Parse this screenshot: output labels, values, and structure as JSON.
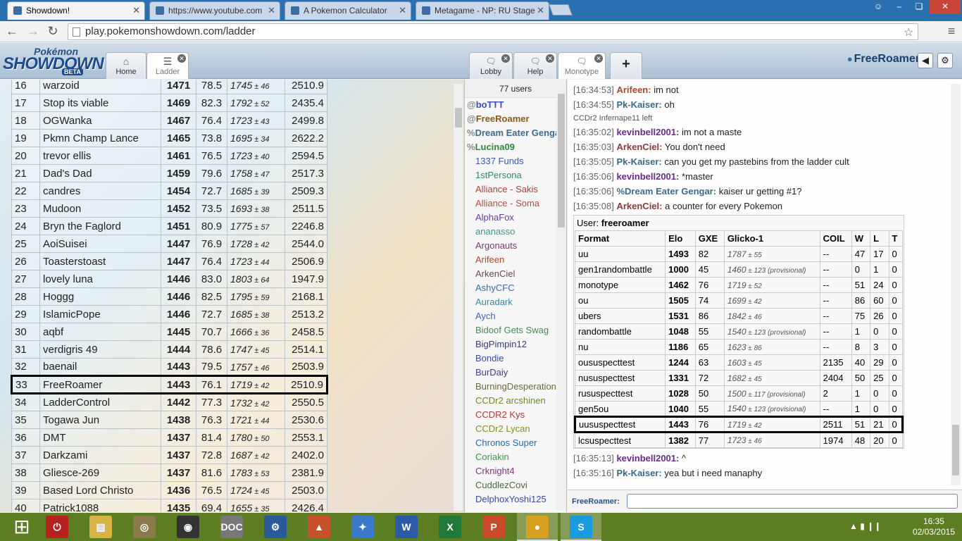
{
  "browser": {
    "tabs": [
      {
        "title": "Showdown!",
        "active": true
      },
      {
        "title": "https://www.youtube.com",
        "active": false
      },
      {
        "title": "A Pokemon Calculator",
        "active": false
      },
      {
        "title": "Metagame - NP: RU Stage",
        "active": false
      }
    ],
    "url": "play.pokemonshowdown.com/ladder",
    "window_buttons": {
      "user": "☺",
      "minimize": "–",
      "restore": "❏",
      "close": "✕"
    },
    "nav": {
      "back": "←",
      "forward": "→",
      "reload": "↻",
      "bookmark": "☆",
      "menu": "≡"
    }
  },
  "showdown": {
    "logo": {
      "line1": "Pokémon",
      "line2": "SHOWDOWN",
      "line3": "BETA"
    },
    "left_tabs": [
      {
        "label": "Home",
        "icon": "home-icon",
        "glyph": "⌂"
      },
      {
        "label": "Ladder",
        "icon": "ladder-icon",
        "glyph": "☰"
      }
    ],
    "room_tabs": [
      {
        "label": "Lobby",
        "icon": "chat-bubble-icon",
        "glyph": "🗨"
      },
      {
        "label": "Help",
        "icon": "chat-bubble-icon",
        "glyph": "🗨"
      },
      {
        "label": "Monotype",
        "icon": "chat-bubble-icon",
        "glyph": "🗨"
      }
    ],
    "add_tab": "+",
    "username": "FreeRoamer",
    "sound_glyph": "◀",
    "settings_glyph": "⚙",
    "close_glyph": "✕"
  },
  "ladder": {
    "rows": [
      {
        "rank": "16",
        "name": "warzoid",
        "elo": "1471",
        "gxe": "78.5",
        "glicko": "1745",
        "dev": "46",
        "coil": "2510.9"
      },
      {
        "rank": "17",
        "name": "Stop its viable",
        "elo": "1469",
        "gxe": "82.3",
        "glicko": "1792",
        "dev": "52",
        "coil": "2435.4"
      },
      {
        "rank": "18",
        "name": "OGWanka",
        "elo": "1467",
        "gxe": "76.4",
        "glicko": "1723",
        "dev": "43",
        "coil": "2499.8"
      },
      {
        "rank": "19",
        "name": "Pkmn Champ Lance",
        "elo": "1465",
        "gxe": "73.8",
        "glicko": "1695",
        "dev": "34",
        "coil": "2622.2"
      },
      {
        "rank": "20",
        "name": "trevor ellis",
        "elo": "1461",
        "gxe": "76.5",
        "glicko": "1723",
        "dev": "40",
        "coil": "2594.5"
      },
      {
        "rank": "21",
        "name": "Dad's Dad",
        "elo": "1459",
        "gxe": "79.6",
        "glicko": "1758",
        "dev": "47",
        "coil": "2517.3"
      },
      {
        "rank": "22",
        "name": "candres",
        "elo": "1454",
        "gxe": "72.7",
        "glicko": "1685",
        "dev": "39",
        "coil": "2509.3"
      },
      {
        "rank": "23",
        "name": "Mudoon",
        "elo": "1452",
        "gxe": "73.5",
        "glicko": "1693",
        "dev": "38",
        "coil": "2511.5"
      },
      {
        "rank": "24",
        "name": "Bryn the Faglord",
        "elo": "1451",
        "gxe": "80.9",
        "glicko": "1775",
        "dev": "57",
        "coil": "2246.8"
      },
      {
        "rank": "25",
        "name": "AoiSuisei",
        "elo": "1447",
        "gxe": "76.9",
        "glicko": "1728",
        "dev": "42",
        "coil": "2544.0"
      },
      {
        "rank": "26",
        "name": "Toasterstoast",
        "elo": "1447",
        "gxe": "76.4",
        "glicko": "1723",
        "dev": "44",
        "coil": "2506.9"
      },
      {
        "rank": "27",
        "name": "lovely luna",
        "elo": "1446",
        "gxe": "83.0",
        "glicko": "1803",
        "dev": "64",
        "coil": "1947.9"
      },
      {
        "rank": "28",
        "name": "Hoggg",
        "elo": "1446",
        "gxe": "82.5",
        "glicko": "1795",
        "dev": "59",
        "coil": "2168.1"
      },
      {
        "rank": "29",
        "name": "IslamicPope",
        "elo": "1446",
        "gxe": "72.7",
        "glicko": "1685",
        "dev": "38",
        "coil": "2513.2"
      },
      {
        "rank": "30",
        "name": "aqbf",
        "elo": "1445",
        "gxe": "70.7",
        "glicko": "1666",
        "dev": "36",
        "coil": "2458.5"
      },
      {
        "rank": "31",
        "name": "verdigris 49",
        "elo": "1444",
        "gxe": "78.6",
        "glicko": "1747",
        "dev": "45",
        "coil": "2514.1"
      },
      {
        "rank": "32",
        "name": "baenail",
        "elo": "1443",
        "gxe": "79.5",
        "glicko": "1757",
        "dev": "46",
        "coil": "2503.9"
      },
      {
        "rank": "33",
        "name": "FreeRoamer",
        "elo": "1443",
        "gxe": "76.1",
        "glicko": "1719",
        "dev": "42",
        "coil": "2510.9",
        "highlight": true
      },
      {
        "rank": "34",
        "name": "LadderControl",
        "elo": "1442",
        "gxe": "77.3",
        "glicko": "1732",
        "dev": "42",
        "coil": "2550.5"
      },
      {
        "rank": "35",
        "name": "Togawa Jun",
        "elo": "1438",
        "gxe": "76.3",
        "glicko": "1721",
        "dev": "44",
        "coil": "2530.6"
      },
      {
        "rank": "36",
        "name": "DMT",
        "elo": "1437",
        "gxe": "81.4",
        "glicko": "1780",
        "dev": "50",
        "coil": "2553.1"
      },
      {
        "rank": "37",
        "name": "Darkzami",
        "elo": "1437",
        "gxe": "72.8",
        "glicko": "1687",
        "dev": "42",
        "coil": "2402.0"
      },
      {
        "rank": "38",
        "name": "Gliesce-269",
        "elo": "1437",
        "gxe": "81.6",
        "glicko": "1783",
        "dev": "53",
        "coil": "2381.9"
      },
      {
        "rank": "39",
        "name": "Based Lord Christo",
        "elo": "1436",
        "gxe": "76.5",
        "glicko": "1724",
        "dev": "45",
        "coil": "2503.0"
      },
      {
        "rank": "40",
        "name": "Patrick1088",
        "elo": "1435",
        "gxe": "69.4",
        "glicko": "1655",
        "dev": "35",
        "coil": "2426.4"
      }
    ]
  },
  "userlist": {
    "count": "77 users",
    "users": [
      {
        "group": "@",
        "name": "boTTT",
        "color": "#3a4fc4",
        "bold": true
      },
      {
        "group": "@",
        "name": "FreeRoamer",
        "color": "#8a5a1a",
        "bold": true
      },
      {
        "group": "%",
        "name": "Dream Eater Gengar",
        "color": "#3d6b8a",
        "bold": true
      },
      {
        "group": "%",
        "name": "Lucina09",
        "color": "#2e8a3a",
        "bold": true
      },
      {
        "group": "",
        "name": "1337 Funds",
        "color": "#3a5ab0",
        "bold": false
      },
      {
        "group": "",
        "name": "1stPersona",
        "color": "#2d8a64",
        "bold": false
      },
      {
        "group": "",
        "name": "Alliance - Sakis",
        "color": "#a8443a",
        "bold": false
      },
      {
        "group": "",
        "name": "Alliance - Soma",
        "color": "#b0503a",
        "bold": false
      },
      {
        "group": "",
        "name": "AlphaFox",
        "color": "#6a3aa8",
        "bold": false
      },
      {
        "group": "",
        "name": "ananasso",
        "color": "#3a9a8a",
        "bold": false
      },
      {
        "group": "",
        "name": "Argonauts",
        "color": "#7a3a6a",
        "bold": false
      },
      {
        "group": "",
        "name": "Arifeen",
        "color": "#a84a2a",
        "bold": false
      },
      {
        "group": "",
        "name": "ArkenCiel",
        "color": "#6a4a4a",
        "bold": false
      },
      {
        "group": "",
        "name": "AshyCFC",
        "color": "#3a6ab0",
        "bold": false
      },
      {
        "group": "",
        "name": "Auradark",
        "color": "#3a8a9a",
        "bold": false
      },
      {
        "group": "",
        "name": "Aych",
        "color": "#3a6aa8",
        "bold": false
      },
      {
        "group": "",
        "name": "Bidoof Gets Swag",
        "color": "#4a8a5a",
        "bold": false
      },
      {
        "group": "",
        "name": "BigPimpin12",
        "color": "#3a3a7a",
        "bold": false
      },
      {
        "group": "",
        "name": "Bondie",
        "color": "#3a4ab0",
        "bold": false
      },
      {
        "group": "",
        "name": "BurDaiy",
        "color": "#4a3a8a",
        "bold": false
      },
      {
        "group": "",
        "name": "BurningDesperation",
        "color": "#6a6a3a",
        "bold": false
      },
      {
        "group": "",
        "name": "CCDr2 arcshinen",
        "color": "#6a8a2a",
        "bold": false
      },
      {
        "group": "",
        "name": "CCDR2 Kys",
        "color": "#b03a3a",
        "bold": false
      },
      {
        "group": "",
        "name": "CCDr2 Lycan",
        "color": "#8a8a2a",
        "bold": false
      },
      {
        "group": "",
        "name": "Chronos Super",
        "color": "#2a6ab0",
        "bold": false
      },
      {
        "group": "",
        "name": "Coriakin",
        "color": "#3a9a4a",
        "bold": false
      },
      {
        "group": "",
        "name": "Crknight4",
        "color": "#7a3a7a",
        "bold": false
      },
      {
        "group": "",
        "name": "CuddlezCovi",
        "color": "#4a6a3a",
        "bold": false
      },
      {
        "group": "",
        "name": "DelphoxYoshi125",
        "color": "#3a4aa8",
        "bold": false
      }
    ]
  },
  "chat": {
    "lines_top": [
      {
        "ts": "[16:34:53]",
        "who": "Arifeen:",
        "color": "#a84a2a",
        "msg": "im not"
      },
      {
        "ts": "[16:34:55]",
        "who": "Pk-Kaiser:",
        "color": "#3a6a8a",
        "msg": "oh"
      },
      {
        "notice": "CCDr2 Infernape11 left"
      },
      {
        "ts": "[16:35:02]",
        "who": "kevinbell2001:",
        "color": "#6a2a8a",
        "msg": "im not a maste"
      },
      {
        "ts": "[16:35:03]",
        "who": "ArkenCiel:",
        "color": "#8a3a3a",
        "msg": "You don't need"
      },
      {
        "ts": "[16:35:05]",
        "who": "Pk-Kaiser:",
        "color": "#3a6a8a",
        "msg": "can you get my pastebins from the ladder cult"
      },
      {
        "ts": "[16:35:06]",
        "who": "kevinbell2001:",
        "color": "#6a2a8a",
        "msg": "*master"
      },
      {
        "ts": "[16:35:06]",
        "who": "%Dream Eater Gengar:",
        "color": "#3d6b8a",
        "msg": "kaiser ur getting #1?"
      },
      {
        "ts": "[16:35:08]",
        "who": "ArkenCiel:",
        "color": "#8a3a3a",
        "msg": "a counter for every Pokemon"
      }
    ],
    "stats_user_label": "User:",
    "stats_user": "freeroamer",
    "stats_headers": [
      "Format",
      "Elo",
      "GXE",
      "Glicko-1",
      "COIL",
      "W",
      "L",
      "T"
    ],
    "stats_rows": [
      {
        "format": "uu",
        "elo": "1493",
        "gxe": "82",
        "glicko": "1787",
        "dev": "55",
        "prov": "",
        "coil": "--",
        "w": "47",
        "l": "17",
        "t": "0"
      },
      {
        "format": "gen1randombattle",
        "elo": "1000",
        "gxe": "45",
        "glicko": "1460",
        "dev": "123",
        "prov": "(provisional)",
        "coil": "--",
        "w": "0",
        "l": "1",
        "t": "0"
      },
      {
        "format": "monotype",
        "elo": "1462",
        "gxe": "76",
        "glicko": "1719",
        "dev": "52",
        "prov": "",
        "coil": "--",
        "w": "51",
        "l": "24",
        "t": "0"
      },
      {
        "format": "ou",
        "elo": "1505",
        "gxe": "74",
        "glicko": "1699",
        "dev": "42",
        "prov": "",
        "coil": "--",
        "w": "86",
        "l": "60",
        "t": "0"
      },
      {
        "format": "ubers",
        "elo": "1531",
        "gxe": "86",
        "glicko": "1842",
        "dev": "46",
        "prov": "",
        "coil": "--",
        "w": "75",
        "l": "26",
        "t": "0"
      },
      {
        "format": "randombattle",
        "elo": "1048",
        "gxe": "55",
        "glicko": "1540",
        "dev": "123",
        "prov": "(provisional)",
        "coil": "--",
        "w": "1",
        "l": "0",
        "t": "0"
      },
      {
        "format": "nu",
        "elo": "1186",
        "gxe": "65",
        "glicko": "1623",
        "dev": "86",
        "prov": "",
        "coil": "--",
        "w": "8",
        "l": "3",
        "t": "0"
      },
      {
        "format": "oususpecttest",
        "elo": "1244",
        "gxe": "63",
        "glicko": "1603",
        "dev": "45",
        "prov": "",
        "coil": "2135",
        "w": "40",
        "l": "29",
        "t": "0"
      },
      {
        "format": "nususpecttest",
        "elo": "1331",
        "gxe": "72",
        "glicko": "1682",
        "dev": "45",
        "prov": "",
        "coil": "2404",
        "w": "50",
        "l": "25",
        "t": "0"
      },
      {
        "format": "rususpecttest",
        "elo": "1028",
        "gxe": "50",
        "glicko": "1500",
        "dev": "117",
        "prov": "(provisional)",
        "coil": "2",
        "w": "1",
        "l": "0",
        "t": "0"
      },
      {
        "format": "gen5ou",
        "elo": "1040",
        "gxe": "55",
        "glicko": "1540",
        "dev": "123",
        "prov": "(provisional)",
        "coil": "--",
        "w": "1",
        "l": "0",
        "t": "0"
      },
      {
        "format": "uususpecttest",
        "elo": "1443",
        "gxe": "76",
        "glicko": "1719",
        "dev": "42",
        "prov": "",
        "coil": "2511",
        "w": "51",
        "l": "21",
        "t": "0",
        "highlight": true
      },
      {
        "format": "lcsuspecttest",
        "elo": "1382",
        "gxe": "77",
        "glicko": "1723",
        "dev": "46",
        "prov": "",
        "coil": "1974",
        "w": "48",
        "l": "20",
        "t": "0"
      }
    ],
    "lines_bottom": [
      {
        "ts": "[16:35:13]",
        "who": "kevinbell2001:",
        "color": "#6a2a8a",
        "msg": "^"
      },
      {
        "ts": "[16:35:16]",
        "who": "Pk-Kaiser:",
        "color": "#3a6a8a",
        "msg": "yea but i need manaphy"
      }
    ],
    "input_name": "FreeRoamer:",
    "input_value": ""
  },
  "taskbar": {
    "apps": [
      {
        "name": "start-icon",
        "glyph": "⊞",
        "color": "transparent"
      },
      {
        "name": "power-icon",
        "glyph": "⏻",
        "color": "#b82020"
      },
      {
        "name": "file-explorer-icon",
        "glyph": "▤",
        "color": "#d8b448"
      },
      {
        "name": "media-icon",
        "glyph": "◎",
        "color": "#8a7a4a"
      },
      {
        "name": "speaker-icon",
        "glyph": "◉",
        "color": "#333333"
      },
      {
        "name": "document-viewer-icon",
        "glyph": "DOC",
        "color": "#777777"
      },
      {
        "name": "settings-app-icon",
        "glyph": "⚙",
        "color": "#2a5a9a"
      },
      {
        "name": "matlab-icon",
        "glyph": "▲",
        "color": "#c8502a"
      },
      {
        "name": "app-icon",
        "glyph": "✦",
        "color": "#3a7ac8"
      },
      {
        "name": "word-icon",
        "glyph": "W",
        "color": "#2a5aa8"
      },
      {
        "name": "excel-icon",
        "glyph": "X",
        "color": "#1f7a3a"
      },
      {
        "name": "powerpoint-icon",
        "glyph": "P",
        "color": "#c84a2a"
      },
      {
        "name": "chrome-icon",
        "glyph": "●",
        "color": "#d8a020",
        "active": true
      },
      {
        "name": "skype-icon",
        "glyph": "S",
        "color": "#1a9ae0",
        "active": true
      }
    ],
    "tray": "▲  ▮  ❙❙",
    "time": "16:35",
    "date": "02/03/2015"
  }
}
